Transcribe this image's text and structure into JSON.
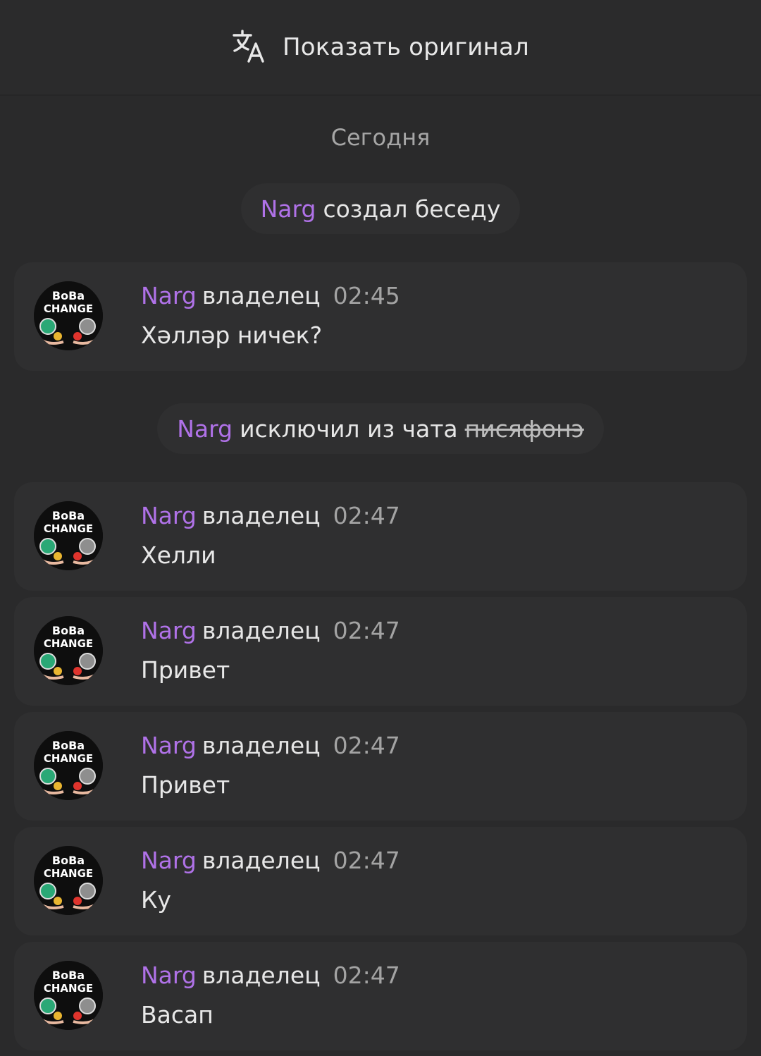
{
  "header": {
    "translate_icon": "translate-icon",
    "show_original_label": "Показать оригинал"
  },
  "chat": {
    "date_separator": "Сегодня",
    "services": [
      {
        "nick": "Narg",
        "action": "создал беседу"
      },
      {
        "nick": "Narg",
        "action": "исключил из чата",
        "target": "писяфонэ"
      }
    ],
    "messages": [
      {
        "author": "Narg",
        "role": "владелец",
        "time": "02:45",
        "text": "Хәлләр ничек?",
        "avatar": {
          "line1": "BoBa",
          "line2": "CHANGE"
        }
      },
      {
        "author": "Narg",
        "role": "владелец",
        "time": "02:47",
        "text": "Хелли",
        "avatar": {
          "line1": "BoBa",
          "line2": "CHANGE"
        }
      },
      {
        "author": "Narg",
        "role": "владелец",
        "time": "02:47",
        "text": "Привет",
        "avatar": {
          "line1": "BoBa",
          "line2": "CHANGE"
        }
      },
      {
        "author": "Narg",
        "role": "владелец",
        "time": "02:47",
        "text": "Привет",
        "avatar": {
          "line1": "BoBa",
          "line2": "CHANGE"
        }
      },
      {
        "author": "Narg",
        "role": "владелец",
        "time": "02:47",
        "text": "Ку",
        "avatar": {
          "line1": "BoBa",
          "line2": "CHANGE"
        }
      },
      {
        "author": "Narg",
        "role": "владелец",
        "time": "02:47",
        "text": "Васап",
        "avatar": {
          "line1": "BoBa",
          "line2": "CHANGE"
        }
      }
    ]
  },
  "colors": {
    "background": "#2a2a2b",
    "bubble": "#2f2f30",
    "nick": "#b072e8",
    "muted": "#a3a3a3"
  }
}
